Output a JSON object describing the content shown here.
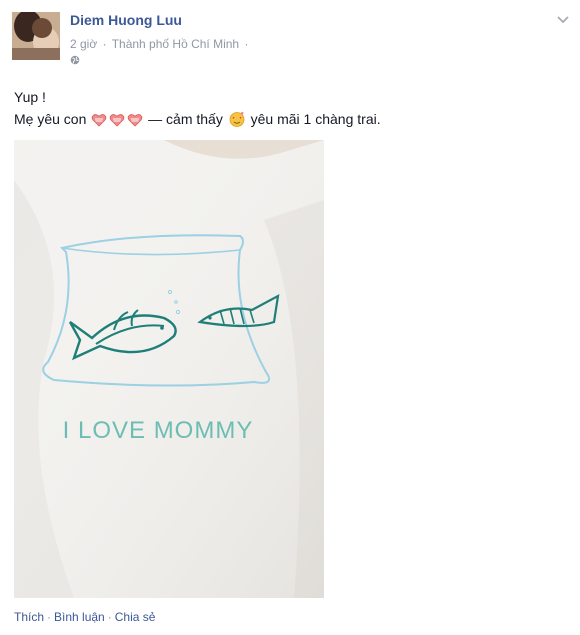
{
  "post": {
    "author": "Diem Huong Luu",
    "time": "2 giờ",
    "location": "Thành phố Hồ Chí Minh",
    "privacy_icon": "globe-icon",
    "menu_icon": "chevron-down-icon"
  },
  "message": {
    "line1": "Yup !",
    "line2_part1": "Mẹ yêu con",
    "line2_part2": "— cảm thấy",
    "line2_part3": "yêu mãi 1 chàng trai."
  },
  "photo": {
    "shirt_print": "I LOVE MOMMY"
  },
  "actions": {
    "like": "Thích",
    "comment": "Bình luận",
    "share": "Chia sẻ",
    "separator": "·"
  },
  "colors": {
    "link": "#3b5998",
    "meta": "#9197a3",
    "fish": "#1f7f78",
    "bowl": "#9cd0e3"
  }
}
